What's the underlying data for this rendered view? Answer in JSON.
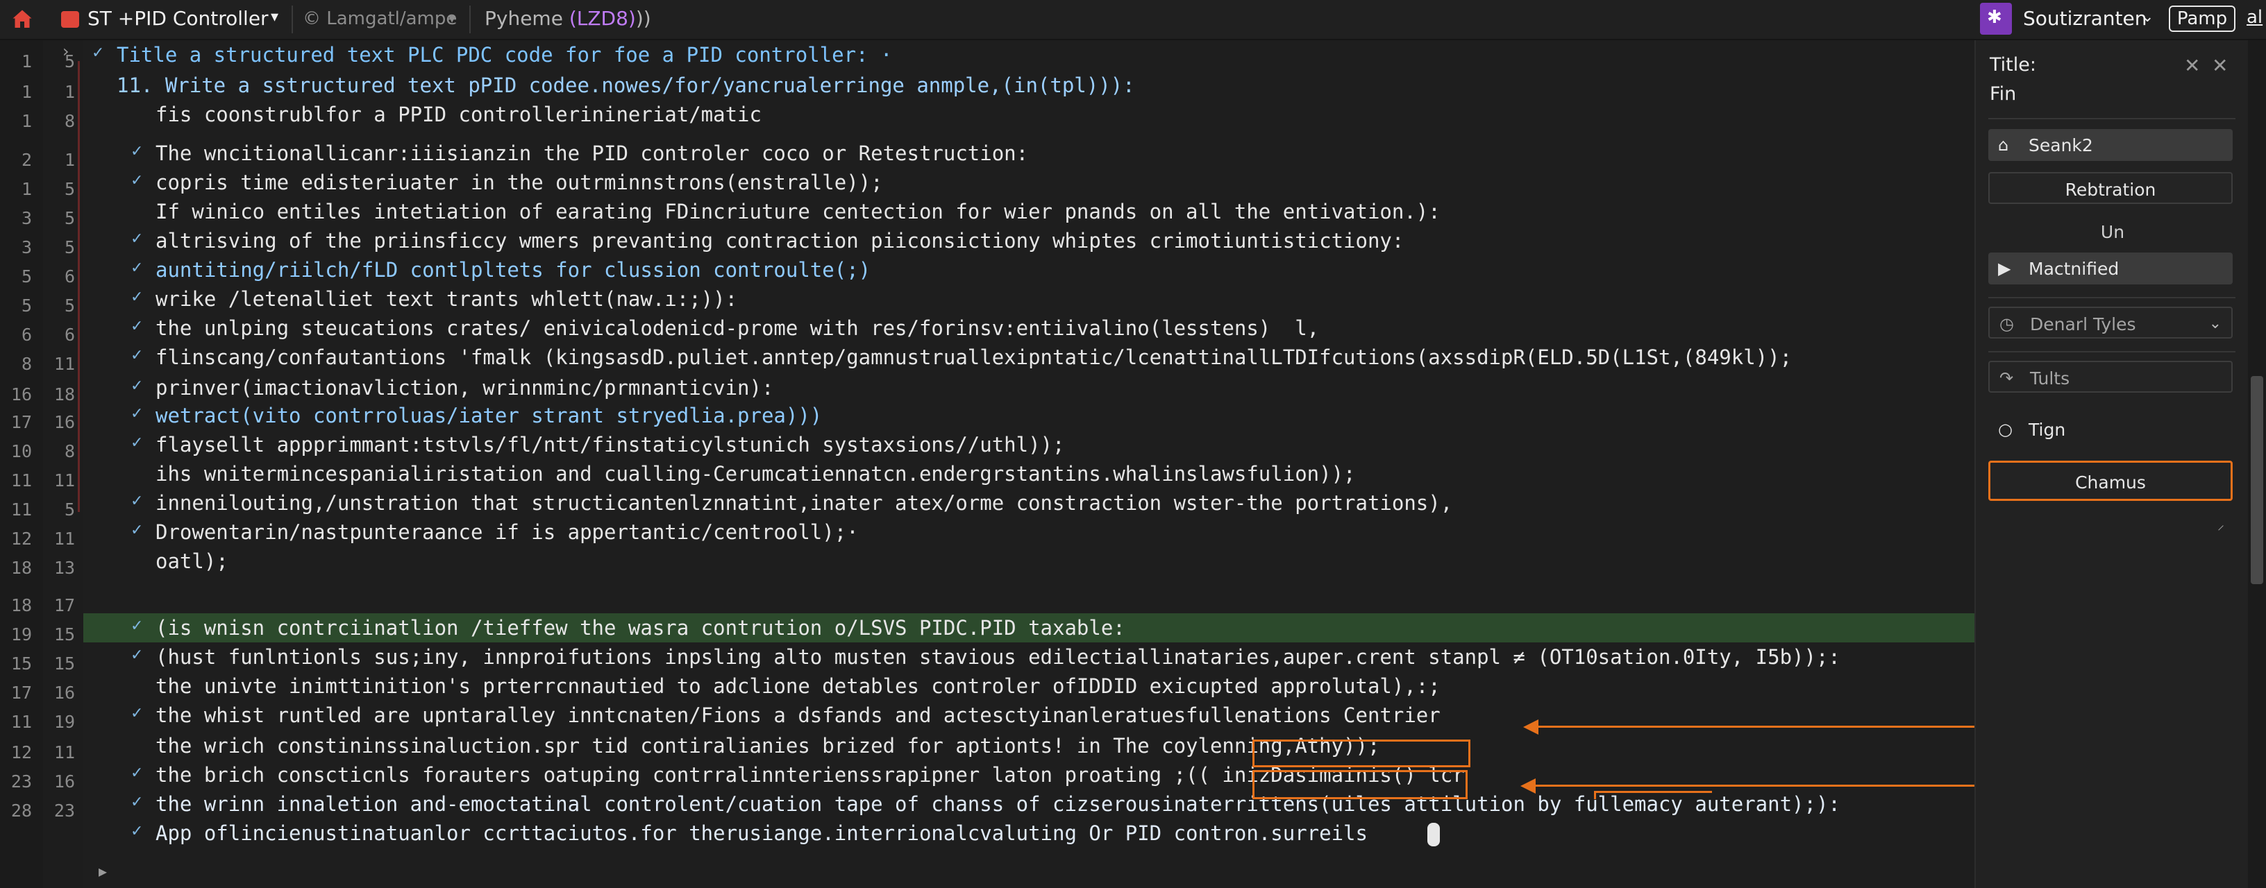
{
  "topbar": {
    "app_title": "ST +PID Controller",
    "crumb1": "© Lamgatl/ampe",
    "crumb2_text": "Pyheme ",
    "crumb2_hl": "(LZD8)",
    "crumb2_tail": "))",
    "account": "Soutizranten",
    "pamp_button": "Pamp",
    "al_link": "al"
  },
  "gutter": {
    "col1": [
      "1",
      "1",
      "1",
      "2",
      "1",
      "3",
      "3",
      "5",
      "5",
      "6",
      "8",
      "16",
      "17",
      "10",
      "11",
      "11",
      "12",
      "18",
      "18",
      "19",
      "15",
      "17",
      "11",
      "12",
      "23",
      "28"
    ],
    "col2": [
      "5",
      "1",
      "8",
      "1",
      "5",
      "5",
      "5",
      "6",
      "5",
      "6",
      "11",
      "18",
      "16",
      "8",
      "11",
      "5",
      "11",
      "13",
      "17",
      "15",
      "15",
      "16",
      "19",
      "11",
      "16",
      "23"
    ]
  },
  "editor": {
    "lines": [
      {
        "check": true,
        "text": "Title a structured text PLC PDC code for foe a PID controller: ·",
        "style": "blue"
      },
      {
        "check": false,
        "text": "11. Write a sstructured text pPID codee.nowes/for/yancrualerringe anmple,(in(tpl))):",
        "style": "mixed1"
      },
      {
        "check": false,
        "text": "fis coonstrublfor a PPID controllerinineriat/matic",
        "style": "plain"
      },
      {
        "check": true,
        "text": "The wncitionallicanr:iiisianzin the PID controler coco or Retestruction:",
        "style": "plain"
      },
      {
        "check": true,
        "text": "copris time edisteriuater in the outrminnstrons(enstralle));",
        "style": "plain"
      },
      {
        "check": false,
        "text": "If winico entiles intetiation of earating FDincriuture centection for wier pnands on all the entivation.):",
        "style": "plain"
      },
      {
        "check": true,
        "text": "altrisving of the priinsficcy wmers prevanting contraction piiconsictiony whiptes crimotiuntistictiony:",
        "style": "plain"
      },
      {
        "check": true,
        "text": "auntiting/riilch/fLD contlpltets for clussion controulte(;)",
        "style": "mixed2"
      },
      {
        "check": true,
        "text": "wrike /letenalliet text trants whlett(naw.ı:;)):",
        "style": "mixed3"
      },
      {
        "check": true,
        "text": "the unlping steucations crates/ enivicalodenicd-prome with res/forinsv:entiivalino(lesstens)  l,",
        "style": "mixed4"
      },
      {
        "check": true,
        "text": "flinscang/confautantions 'fmalk (kingsasdD.puliet.anntep/gamnustruallexipntatic/lcenattinallLTDIfcutions(axssdipR(ELD.5D(L1St,(849kl));",
        "style": "plain"
      },
      {
        "check": true,
        "text": "prinver(imactionavliction, wrinnminc/prmnanticvin):",
        "style": "plain"
      },
      {
        "check": true,
        "text": "wetract(vito contrroluas/iater strant stryedlia.prea)))",
        "style": "mixed5"
      },
      {
        "check": true,
        "text": "flaysellt appprimmant:tstvls/fl/ntt/finstaticylstunich systaxsions//uthl));",
        "style": "mixed6"
      },
      {
        "check": false,
        "text": "ihs wnitermincespanialiristation and cualling-Cerumcatiennatcn.endergrstantins.whalinslawsfulion));",
        "style": "mixed7"
      },
      {
        "check": true,
        "text": "innenilouting,/unstration that structicantenlznnatint,inater atex/orme constraction wster-the portrations),",
        "style": "mixed8"
      },
      {
        "check": true,
        "text": "Drowentarin/nastpunteraance if is appertantic/centrooll);·",
        "style": "mixed9"
      },
      {
        "check": false,
        "text": "oatl);",
        "style": "plain"
      },
      {
        "check": false,
        "text": "",
        "style": "plain"
      },
      {
        "check": true,
        "text": "(is wnisn contrciinatlion /tieffew the wasra contrution o/LSVS PIDC.PID taxable:",
        "style": "hl"
      },
      {
        "check": true,
        "text": "(hust funlntionls sus;iny, innproifutions inpsling alto musten stavious edilectiallinataries,auper.crent stanpl ≠ (OT10sation.0Ity, I5b));:",
        "style": "plain"
      },
      {
        "check": false,
        "text": "the univte inimttinition's prterrcnnautied to adclione detables controler ofIDDID exicupted approlutal),:;",
        "style": "plain"
      },
      {
        "check": true,
        "text": "the whist runtled are upntaralley inntcnaten/Fions a dsfands and actesctyinanleratuesfullenations Centrier",
        "style": "plain"
      },
      {
        "check": false,
        "text": "the wrich constininssinaluction.spr tid contiralianies brized for aptionts! in The coylenning,Athy));",
        "style": "plain"
      },
      {
        "check": true,
        "text": "the brich conscticnls forauters oatuping contrralinnterienssrapipner laton proating ;(( inizDasimainis() lcr",
        "style": "plain"
      },
      {
        "check": true,
        "text": "the wrinn innaletion and-emoctatinal controlent/cuation tape of chanss of cizserousinaterrittens(uiles attilution by fullemacy auterant);):",
        "style": "mixed10"
      },
      {
        "check": true,
        "text": "App oflincienustinatuanlor ccrttaciutos.for therusiange.interrionalcvaluting Or PID contron.surreils",
        "style": "mixed11"
      }
    ]
  },
  "panel": {
    "title": "Title:",
    "subtitle": "Fin",
    "btn_search": "Seank2",
    "btn_rebtration": "Rebtration",
    "un_label": "Un",
    "btn_mactnified": "Mactnified",
    "dropdown_label": "Denarl Tyles",
    "btn_tults": "Tults",
    "btn_tign": "Tign",
    "btn_chamus": "Chamus"
  },
  "colors": {
    "accent_orange": "#e7711b",
    "highlight_row": "#2c4a2c",
    "keyword_blue": "#7ec3ff",
    "extension_purple": "#7b38b8"
  },
  "icons": [
    "home-icon",
    "app-icon",
    "extension-icon",
    "check-icon",
    "fold-icon",
    "close-icon",
    "home-small-icon",
    "play-icon",
    "clock-icon",
    "redo-icon",
    "circle-icon",
    "chevron-down-icon"
  ]
}
